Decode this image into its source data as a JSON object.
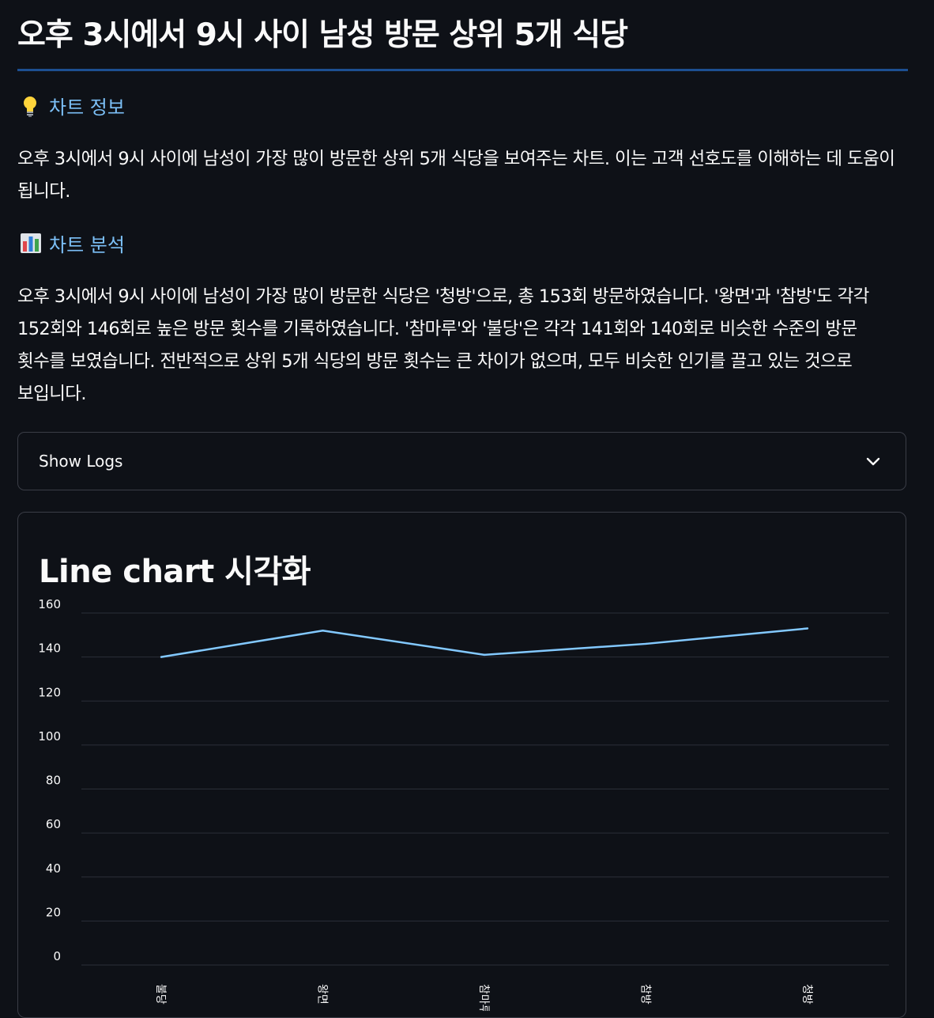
{
  "page": {
    "title": "오후 3시에서 9시 사이 남성 방문 상위 5개 식당"
  },
  "info_section": {
    "icon": "lightbulb-icon",
    "heading": "차트 정보",
    "text": "오후 3시에서 9시 사이에 남성이 가장 많이 방문한 상위 5개 식당을 보여주는 차트. 이는 고객 선호도를 이해하는 데 도움이 됩니다."
  },
  "analysis_section": {
    "icon": "bar-chart-icon",
    "heading": "차트 분석",
    "text": "오후 3시에서 9시 사이에 남성이 가장 많이 방문한 식당은 '청방'으로, 총 153회 방문하였습니다. '왕면'과 '참방'도 각각 152회와 146회로 높은 방문 횟수를 기록하였습니다. '참마루'와 '불당'은 각각 141회와 140회로 비슷한 수준의 방문 횟수를 보였습니다. 전반적으로 상위 5개 식당의 방문 횟수는 큰 차이가 없으며, 모두 비슷한 인기를 끌고 있는 것으로 보입니다."
  },
  "expander": {
    "label": "Show Logs",
    "icon": "chevron-down-icon"
  },
  "chart_card": {
    "title": "Line chart 시각화"
  },
  "chart_data": {
    "type": "line",
    "categories": [
      "불당",
      "왕면",
      "참마루",
      "참방",
      "청방"
    ],
    "series": [
      {
        "values": [
          140,
          152,
          141,
          146,
          153
        ],
        "color": "#83c9ff"
      }
    ],
    "yticks": [
      0,
      20,
      40,
      60,
      80,
      100,
      120,
      140,
      160
    ],
    "ylim": [
      0,
      160
    ],
    "grid": true,
    "colors": {
      "line": "#83c9ff",
      "grid": "#2b2f38"
    }
  }
}
